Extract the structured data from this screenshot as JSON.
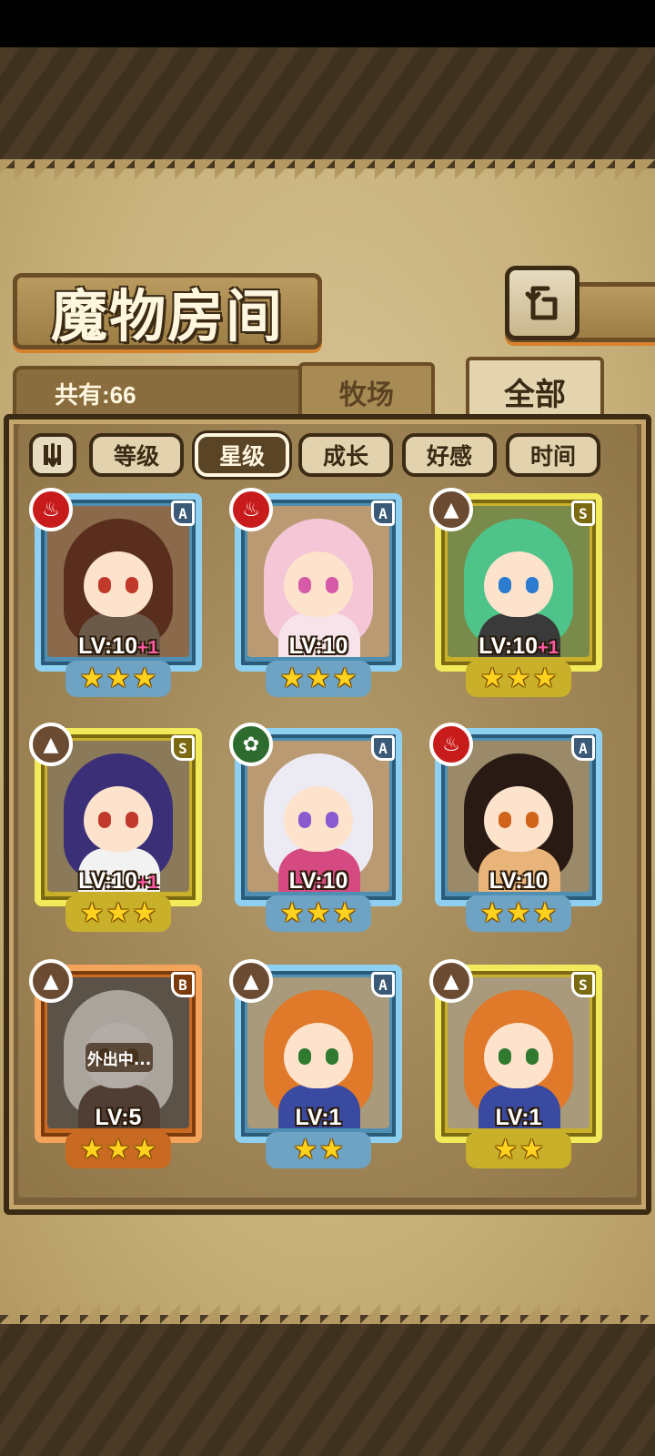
{
  "header": {
    "title": "魔物房间",
    "back_icon": "return-arrow-icon"
  },
  "summary": {
    "count_text": "共有:66"
  },
  "tabs": [
    {
      "label": "牧场",
      "selected": false
    },
    {
      "label": "全部",
      "selected": true
    }
  ],
  "sort": {
    "toggle_icon": "sort-order-toggle-icon",
    "options": [
      {
        "label": "等级",
        "active": false
      },
      {
        "label": "星级",
        "active": true
      },
      {
        "label": "成长",
        "active": false
      },
      {
        "label": "好感",
        "active": false
      },
      {
        "label": "时间",
        "active": false
      }
    ]
  },
  "monsters": [
    {
      "element": "fire",
      "grade": "A",
      "level": "LV:10",
      "bonus": "+1",
      "stars": 3,
      "away": false,
      "colors": {
        "hair": "#5a2e1c",
        "eye": "#c0392b",
        "body": "#6b5a4a",
        "bg": "#8a6a4a"
      }
    },
    {
      "element": "fire",
      "grade": "A",
      "level": "LV:10",
      "bonus": "",
      "stars": 3,
      "away": false,
      "colors": {
        "hair": "#f4c6d6",
        "eye": "#d65aa8",
        "body": "#f7e3ea",
        "bg": "#b99a72"
      }
    },
    {
      "element": "earth",
      "grade": "S",
      "level": "LV:10",
      "bonus": "+1",
      "stars": 3,
      "away": false,
      "colors": {
        "hair": "#4fc48a",
        "eye": "#2b7bd0",
        "body": "#3a3a3a",
        "bg": "#7a8a4a"
      }
    },
    {
      "element": "earth",
      "grade": "S",
      "level": "LV:10",
      "bonus": "+1",
      "stars": 3,
      "away": false,
      "colors": {
        "hair": "#3b2f78",
        "eye": "#c0392b",
        "body": "#f2f2f2",
        "bg": "#8a7a5a"
      }
    },
    {
      "element": "nature",
      "grade": "A",
      "level": "LV:10",
      "bonus": "",
      "stars": 3,
      "away": false,
      "colors": {
        "hair": "#eceaf2",
        "eye": "#8a5ad0",
        "body": "#d64a82",
        "bg": "#b99a72"
      }
    },
    {
      "element": "fire",
      "grade": "A",
      "level": "LV:10",
      "bonus": "",
      "stars": 3,
      "away": false,
      "colors": {
        "hair": "#2a1a14",
        "eye": "#d0641a",
        "body": "#e8b47a",
        "bg": "#9a8a6a"
      }
    },
    {
      "element": "earth",
      "grade": "B",
      "level": "LV:5",
      "bonus": "",
      "stars": 3,
      "away": true,
      "away_text": "外出中...",
      "colors": {
        "hair": "#e8dcc0",
        "eye": "#b05a1a",
        "body": "#8a4a2a",
        "bg": "#8a6a4a"
      }
    },
    {
      "element": "earth",
      "grade": "A",
      "level": "LV:1",
      "bonus": "",
      "stars": 2,
      "away": false,
      "colors": {
        "hair": "#e07a2a",
        "eye": "#2f7a2f",
        "body": "#3a4aa0",
        "bg": "#a89a7a"
      }
    },
    {
      "element": "earth",
      "grade": "S",
      "level": "LV:1",
      "bonus": "",
      "stars": 2,
      "away": false,
      "colors": {
        "hair": "#e07a2a",
        "eye": "#2f7a2f",
        "body": "#3a4aa0",
        "bg": "#a89a7a"
      }
    }
  ]
}
